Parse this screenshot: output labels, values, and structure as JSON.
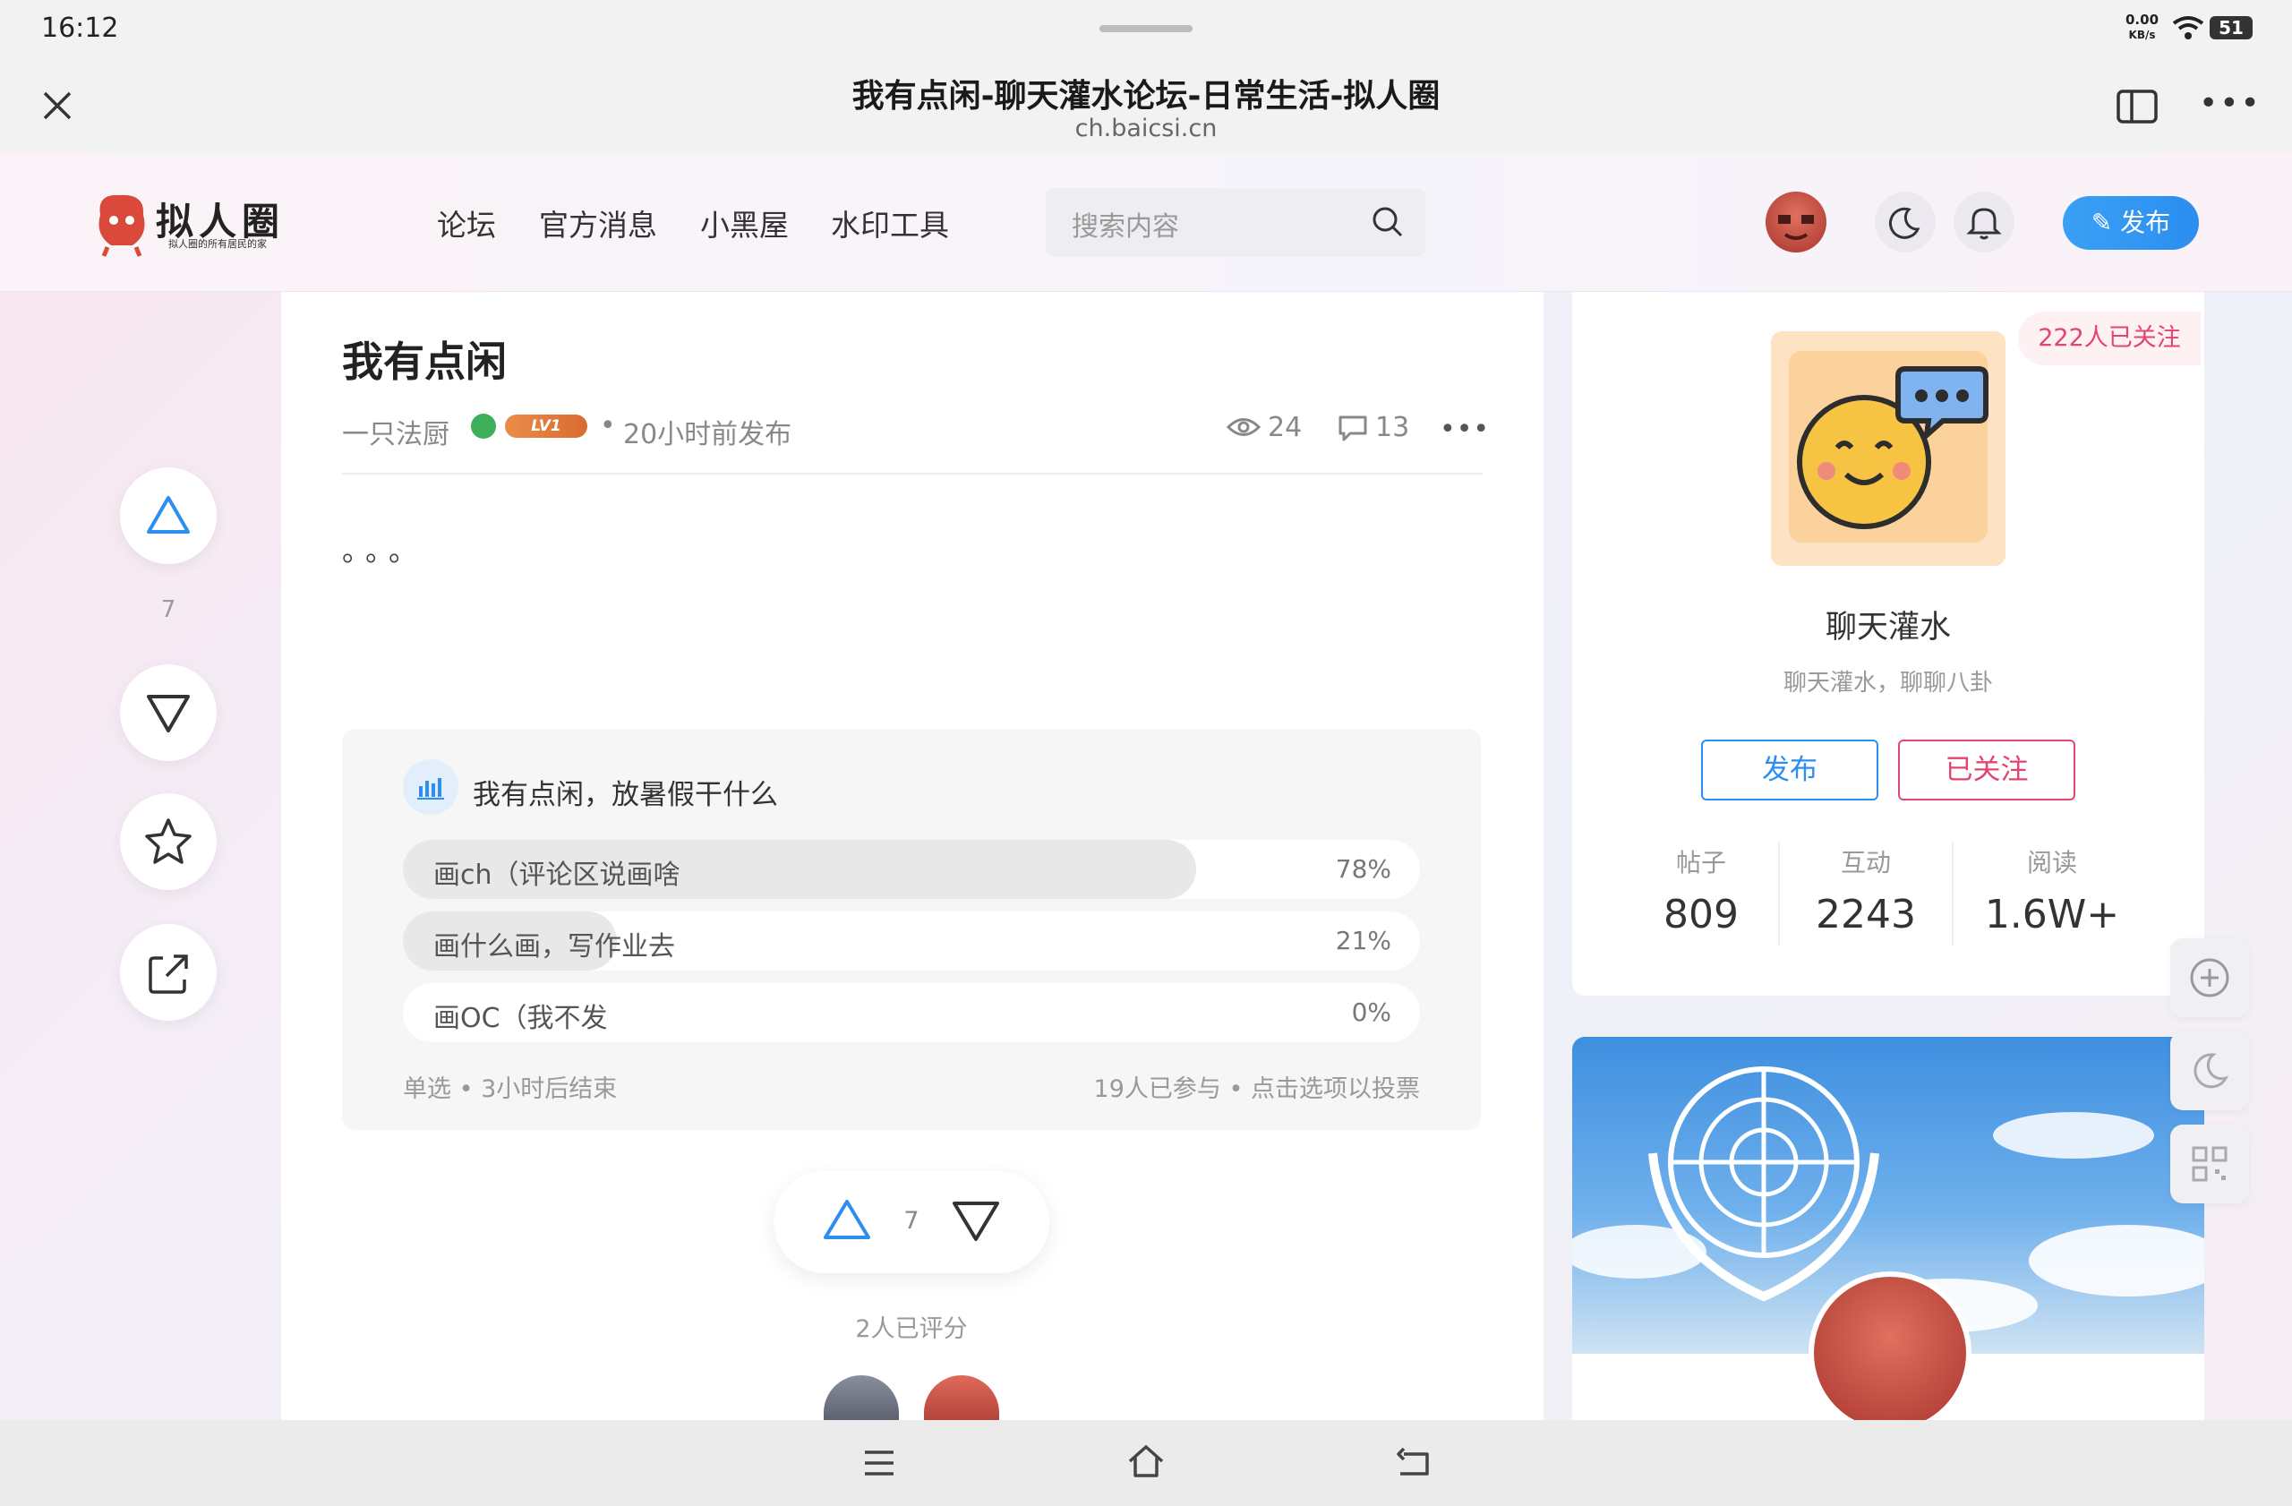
{
  "status": {
    "time": "16:12",
    "net_speed": "0.00",
    "net_unit": "KB/s",
    "battery": "51"
  },
  "browser": {
    "title": "我有点闲-聊天灌水论坛-日常生活-拟人圈",
    "url": "ch.baicsi.cn"
  },
  "site": {
    "logo_text": "拟人圈",
    "logo_sub": "拟人圈的所有居民的家",
    "nav": [
      "论坛",
      "官方消息",
      "小黑屋",
      "水印工具"
    ],
    "search_placeholder": "搜索内容",
    "publish_label": "发布"
  },
  "post": {
    "title": "我有点闲",
    "author": "一只法厨",
    "level": "LV1",
    "time": "20小时前发布",
    "views": "24",
    "comments": "13",
    "body": "。。。",
    "vote_count": "7"
  },
  "poll": {
    "question": "我有点闲，放暑假干什么",
    "options": [
      {
        "label": "画ch（评论区说画啥",
        "percent": 78,
        "percent_text": "78%"
      },
      {
        "label": "画什么画，写作业去",
        "percent": 21,
        "percent_text": "21%"
      },
      {
        "label": "画OC（我不发",
        "percent": 0,
        "percent_text": "0%"
      }
    ],
    "mode": "单选",
    "deadline": "3小时后结束",
    "participants": "19人已参与",
    "hint": "点击选项以投票"
  },
  "rating": {
    "count_text": "2人已评分",
    "vote_count": "7"
  },
  "forum": {
    "followers": "222人已关注",
    "name": "聊天灌水",
    "desc": "聊天灌水，聊聊八卦",
    "publish_label": "发布",
    "followed_label": "已关注",
    "stats": [
      {
        "label": "帖子",
        "value": "809"
      },
      {
        "label": "互动",
        "value": "2243"
      },
      {
        "label": "阅读",
        "value": "1.6W+"
      }
    ]
  },
  "colors": {
    "accent": "#2b8ef0",
    "follow": "#e0466e",
    "bar_bg": "#f2f2f3"
  }
}
